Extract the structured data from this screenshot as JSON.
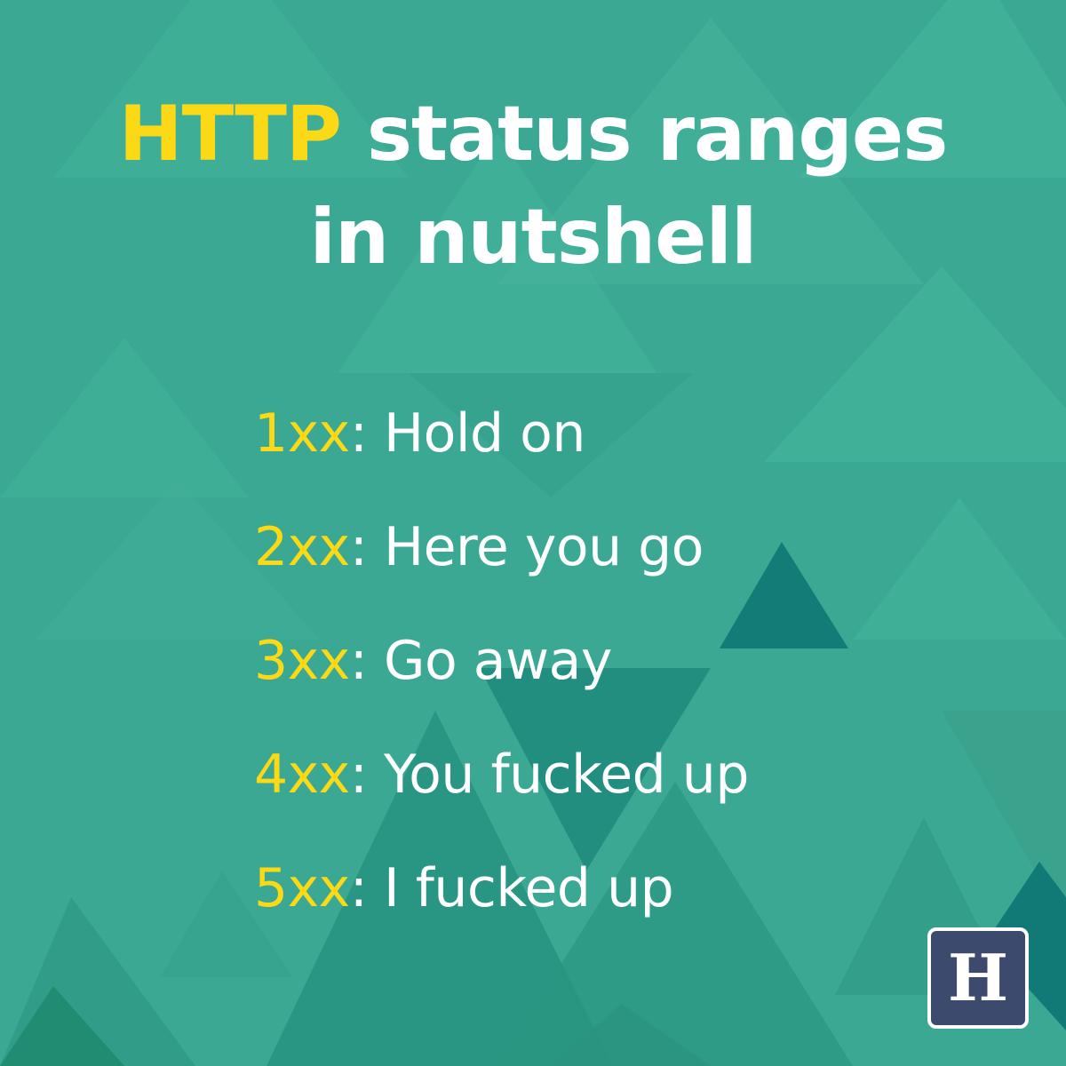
{
  "colors": {
    "background": "#3aa892",
    "accent": "#fcd916",
    "text": "#ffffff",
    "triangle_light": "#4dbba2",
    "triangle_dark": "#1f8f80",
    "triangle_deep": "#127a76",
    "logo_background": "#3c4a6e"
  },
  "title": {
    "highlight": "HTTP",
    "rest_line1": " status ranges",
    "line2": "in nutshell"
  },
  "ranges": [
    {
      "code": "1xx",
      "separator": ": ",
      "meaning": "Hold on"
    },
    {
      "code": "2xx",
      "separator": ": ",
      "meaning": "Here you go"
    },
    {
      "code": "3xx",
      "separator": ": ",
      "meaning": "Go away"
    },
    {
      "code": "4xx",
      "separator": ": ",
      "meaning": "You fucked up"
    },
    {
      "code": "5xx",
      "separator": ": ",
      "meaning": "I fucked up"
    }
  ],
  "logo": {
    "letter": "H",
    "icon": "h-logo-icon"
  }
}
